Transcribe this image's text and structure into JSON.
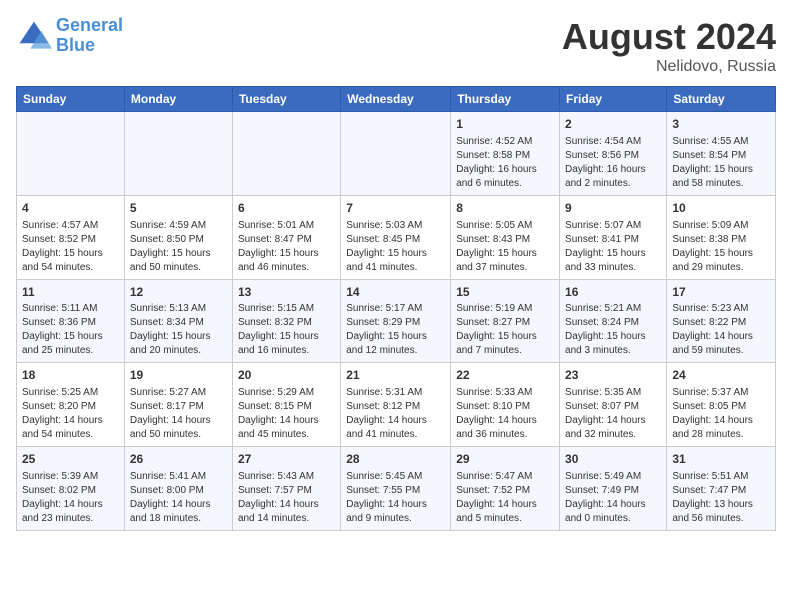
{
  "header": {
    "logo_line1": "General",
    "logo_line2": "Blue",
    "month_year": "August 2024",
    "location": "Nelidovo, Russia"
  },
  "weekdays": [
    "Sunday",
    "Monday",
    "Tuesday",
    "Wednesday",
    "Thursday",
    "Friday",
    "Saturday"
  ],
  "weeks": [
    [
      {
        "day": "",
        "content": ""
      },
      {
        "day": "",
        "content": ""
      },
      {
        "day": "",
        "content": ""
      },
      {
        "day": "",
        "content": ""
      },
      {
        "day": "1",
        "content": "Sunrise: 4:52 AM\nSunset: 8:58 PM\nDaylight: 16 hours\nand 6 minutes."
      },
      {
        "day": "2",
        "content": "Sunrise: 4:54 AM\nSunset: 8:56 PM\nDaylight: 16 hours\nand 2 minutes."
      },
      {
        "day": "3",
        "content": "Sunrise: 4:55 AM\nSunset: 8:54 PM\nDaylight: 15 hours\nand 58 minutes."
      }
    ],
    [
      {
        "day": "4",
        "content": "Sunrise: 4:57 AM\nSunset: 8:52 PM\nDaylight: 15 hours\nand 54 minutes."
      },
      {
        "day": "5",
        "content": "Sunrise: 4:59 AM\nSunset: 8:50 PM\nDaylight: 15 hours\nand 50 minutes."
      },
      {
        "day": "6",
        "content": "Sunrise: 5:01 AM\nSunset: 8:47 PM\nDaylight: 15 hours\nand 46 minutes."
      },
      {
        "day": "7",
        "content": "Sunrise: 5:03 AM\nSunset: 8:45 PM\nDaylight: 15 hours\nand 41 minutes."
      },
      {
        "day": "8",
        "content": "Sunrise: 5:05 AM\nSunset: 8:43 PM\nDaylight: 15 hours\nand 37 minutes."
      },
      {
        "day": "9",
        "content": "Sunrise: 5:07 AM\nSunset: 8:41 PM\nDaylight: 15 hours\nand 33 minutes."
      },
      {
        "day": "10",
        "content": "Sunrise: 5:09 AM\nSunset: 8:38 PM\nDaylight: 15 hours\nand 29 minutes."
      }
    ],
    [
      {
        "day": "11",
        "content": "Sunrise: 5:11 AM\nSunset: 8:36 PM\nDaylight: 15 hours\nand 25 minutes."
      },
      {
        "day": "12",
        "content": "Sunrise: 5:13 AM\nSunset: 8:34 PM\nDaylight: 15 hours\nand 20 minutes."
      },
      {
        "day": "13",
        "content": "Sunrise: 5:15 AM\nSunset: 8:32 PM\nDaylight: 15 hours\nand 16 minutes."
      },
      {
        "day": "14",
        "content": "Sunrise: 5:17 AM\nSunset: 8:29 PM\nDaylight: 15 hours\nand 12 minutes."
      },
      {
        "day": "15",
        "content": "Sunrise: 5:19 AM\nSunset: 8:27 PM\nDaylight: 15 hours\nand 7 minutes."
      },
      {
        "day": "16",
        "content": "Sunrise: 5:21 AM\nSunset: 8:24 PM\nDaylight: 15 hours\nand 3 minutes."
      },
      {
        "day": "17",
        "content": "Sunrise: 5:23 AM\nSunset: 8:22 PM\nDaylight: 14 hours\nand 59 minutes."
      }
    ],
    [
      {
        "day": "18",
        "content": "Sunrise: 5:25 AM\nSunset: 8:20 PM\nDaylight: 14 hours\nand 54 minutes."
      },
      {
        "day": "19",
        "content": "Sunrise: 5:27 AM\nSunset: 8:17 PM\nDaylight: 14 hours\nand 50 minutes."
      },
      {
        "day": "20",
        "content": "Sunrise: 5:29 AM\nSunset: 8:15 PM\nDaylight: 14 hours\nand 45 minutes."
      },
      {
        "day": "21",
        "content": "Sunrise: 5:31 AM\nSunset: 8:12 PM\nDaylight: 14 hours\nand 41 minutes."
      },
      {
        "day": "22",
        "content": "Sunrise: 5:33 AM\nSunset: 8:10 PM\nDaylight: 14 hours\nand 36 minutes."
      },
      {
        "day": "23",
        "content": "Sunrise: 5:35 AM\nSunset: 8:07 PM\nDaylight: 14 hours\nand 32 minutes."
      },
      {
        "day": "24",
        "content": "Sunrise: 5:37 AM\nSunset: 8:05 PM\nDaylight: 14 hours\nand 28 minutes."
      }
    ],
    [
      {
        "day": "25",
        "content": "Sunrise: 5:39 AM\nSunset: 8:02 PM\nDaylight: 14 hours\nand 23 minutes."
      },
      {
        "day": "26",
        "content": "Sunrise: 5:41 AM\nSunset: 8:00 PM\nDaylight: 14 hours\nand 18 minutes."
      },
      {
        "day": "27",
        "content": "Sunrise: 5:43 AM\nSunset: 7:57 PM\nDaylight: 14 hours\nand 14 minutes."
      },
      {
        "day": "28",
        "content": "Sunrise: 5:45 AM\nSunset: 7:55 PM\nDaylight: 14 hours\nand 9 minutes."
      },
      {
        "day": "29",
        "content": "Sunrise: 5:47 AM\nSunset: 7:52 PM\nDaylight: 14 hours\nand 5 minutes."
      },
      {
        "day": "30",
        "content": "Sunrise: 5:49 AM\nSunset: 7:49 PM\nDaylight: 14 hours\nand 0 minutes."
      },
      {
        "day": "31",
        "content": "Sunrise: 5:51 AM\nSunset: 7:47 PM\nDaylight: 13 hours\nand 56 minutes."
      }
    ]
  ]
}
